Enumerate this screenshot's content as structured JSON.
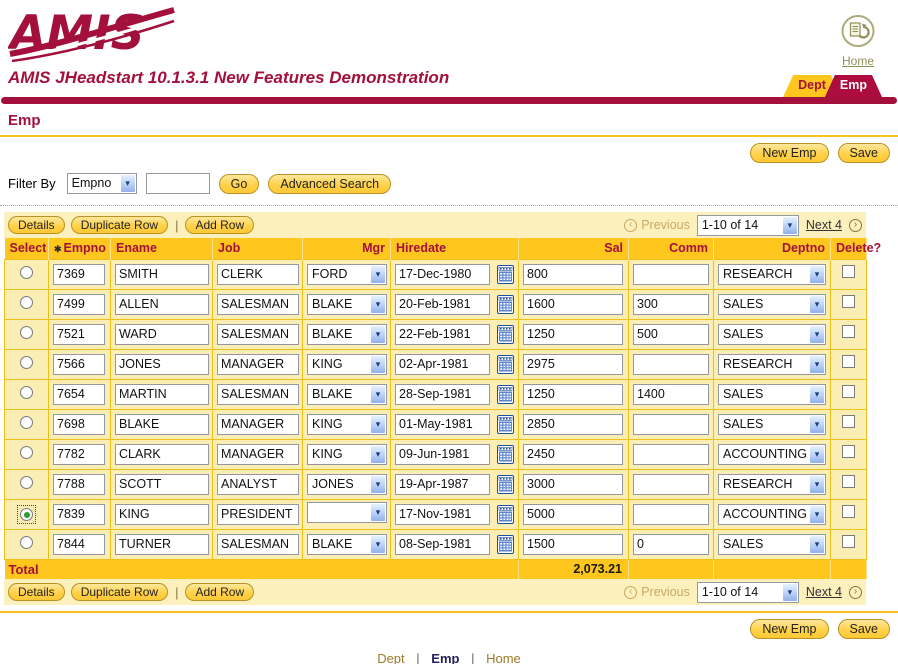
{
  "header": {
    "logo_text": "AMIS",
    "home_label": "Home",
    "title": "AMIS JHeadstart 10.1.3.1 New Features Demonstration",
    "tabs": [
      {
        "label": "Dept",
        "active": false
      },
      {
        "label": "Emp",
        "active": true
      }
    ]
  },
  "page": {
    "title": "Emp"
  },
  "actions": {
    "new_emp": "New Emp",
    "save": "Save"
  },
  "filter": {
    "label": "Filter By",
    "field_selected": "Empno",
    "search_value": "",
    "go": "Go",
    "advanced": "Advanced Search"
  },
  "toolbar": {
    "details": "Details",
    "duplicate_row": "Duplicate Row",
    "separator": "|",
    "add_row": "Add Row"
  },
  "pager": {
    "previous": "Previous",
    "range": "1-10 of 14",
    "next": "Next 4"
  },
  "icons": {
    "chevron_down": "▾",
    "chevron_left": "‹",
    "chevron_right": "›",
    "required": "✱"
  },
  "table": {
    "columns": [
      {
        "label": "Select",
        "align": "left"
      },
      {
        "label": "Empno",
        "align": "left",
        "required": true
      },
      {
        "label": "Ename",
        "align": "left"
      },
      {
        "label": "Job",
        "align": "left"
      },
      {
        "label": "Mgr",
        "align": "right"
      },
      {
        "label": "Hiredate",
        "align": "left"
      },
      {
        "label": "Sal",
        "align": "right"
      },
      {
        "label": "Comm",
        "align": "right"
      },
      {
        "label": "Deptno",
        "align": "right"
      },
      {
        "label": "Delete?",
        "align": "left"
      }
    ],
    "rows": [
      {
        "empno": "7369",
        "ename": "SMITH",
        "job": "CLERK",
        "mgr": "FORD",
        "hiredate": "17-Dec-1980",
        "sal": "800",
        "comm": "",
        "deptno": "RESEARCH",
        "selected": false
      },
      {
        "empno": "7499",
        "ename": "ALLEN",
        "job": "SALESMAN",
        "mgr": "BLAKE",
        "hiredate": "20-Feb-1981",
        "sal": "1600",
        "comm": "300",
        "deptno": "SALES",
        "selected": false
      },
      {
        "empno": "7521",
        "ename": "WARD",
        "job": "SALESMAN",
        "mgr": "BLAKE",
        "hiredate": "22-Feb-1981",
        "sal": "1250",
        "comm": "500",
        "deptno": "SALES",
        "selected": false
      },
      {
        "empno": "7566",
        "ename": "JONES",
        "job": "MANAGER",
        "mgr": "KING",
        "hiredate": "02-Apr-1981",
        "sal": "2975",
        "comm": "",
        "deptno": "RESEARCH",
        "selected": false
      },
      {
        "empno": "7654",
        "ename": "MARTIN",
        "job": "SALESMAN",
        "mgr": "BLAKE",
        "hiredate": "28-Sep-1981",
        "sal": "1250",
        "comm": "1400",
        "deptno": "SALES",
        "selected": false
      },
      {
        "empno": "7698",
        "ename": "BLAKE",
        "job": "MANAGER",
        "mgr": "KING",
        "hiredate": "01-May-1981",
        "sal": "2850",
        "comm": "",
        "deptno": "SALES",
        "selected": false
      },
      {
        "empno": "7782",
        "ename": "CLARK",
        "job": "MANAGER",
        "mgr": "KING",
        "hiredate": "09-Jun-1981",
        "sal": "2450",
        "comm": "",
        "deptno": "ACCOUNTING",
        "selected": false
      },
      {
        "empno": "7788",
        "ename": "SCOTT",
        "job": "ANALYST",
        "mgr": "JONES",
        "hiredate": "19-Apr-1987",
        "sal": "3000",
        "comm": "",
        "deptno": "RESEARCH",
        "selected": false
      },
      {
        "empno": "7839",
        "ename": "KING",
        "job": "PRESIDENT",
        "mgr": "",
        "hiredate": "17-Nov-1981",
        "sal": "5000",
        "comm": "",
        "deptno": "ACCOUNTING",
        "selected": true
      },
      {
        "empno": "7844",
        "ename": "TURNER",
        "job": "SALESMAN",
        "mgr": "BLAKE",
        "hiredate": "08-Sep-1981",
        "sal": "1500",
        "comm": "0",
        "deptno": "SALES",
        "selected": false
      }
    ],
    "total_label": "Total",
    "total_value": "2,073.21"
  },
  "footer": {
    "links": [
      "Dept",
      "Emp",
      "Home"
    ],
    "separator": "|"
  },
  "colors": {
    "maroon": "#A3103C",
    "tab_emp": "#AD0C3F",
    "gold_header": "#FFC61E",
    "row_bg": "#FBEEB4",
    "band_bg": "#FCF0BC",
    "button_border": "#B89323",
    "disabled_pager": "#C9A963"
  }
}
